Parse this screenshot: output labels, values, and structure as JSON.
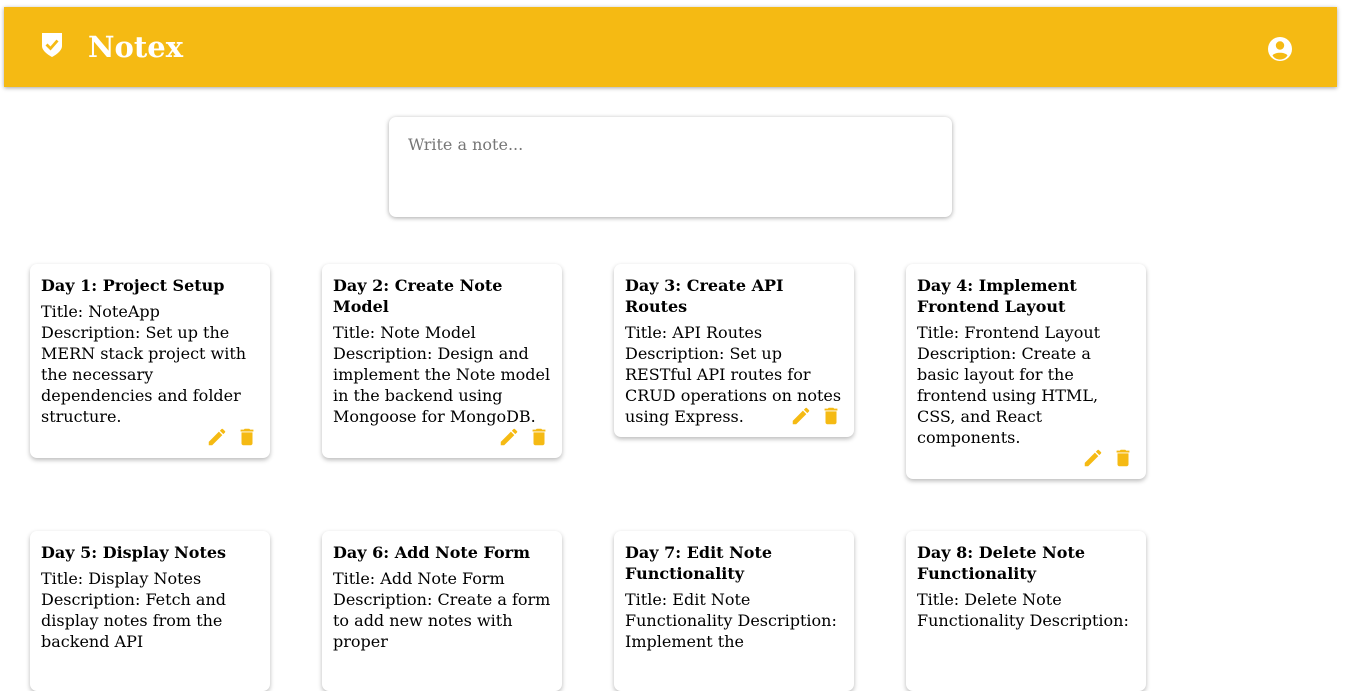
{
  "header": {
    "title": "Notex",
    "logo_icon": "check-shield-icon",
    "account_icon": "account-circle-icon",
    "color": "#f5ba13"
  },
  "composer": {
    "placeholder": "Write a note..."
  },
  "notes": [
    {
      "title": "Day 1: Project Setup",
      "content": "Title: NoteApp Description: Set up the MERN stack project with the necessary dependencies and folder structure."
    },
    {
      "title": "Day 2: Create Note Model",
      "content": "Title: Note Model Description: Design and implement the Note model in the backend using Mongoose for MongoDB."
    },
    {
      "title": "Day 3: Create API Routes",
      "content": "Title: API Routes Description: Set up RESTful API routes for CRUD operations on notes using Express."
    },
    {
      "title": "Day 4: Implement Frontend Layout",
      "content": "Title: Frontend Layout Description: Create a basic layout for the frontend using HTML, CSS, and React components."
    },
    {
      "title": "Day 5: Display Notes",
      "content": "Title: Display Notes Description: Fetch and display notes from the backend API"
    },
    {
      "title": "Day 6: Add Note Form",
      "content": "Title: Add Note Form Description: Create a form to add new notes with proper"
    },
    {
      "title": "Day 7: Edit Note Functionality",
      "content": "Title: Edit Note Functionality Description: Implement the"
    },
    {
      "title": "Day 8: Delete Note Functionality",
      "content": "Title: Delete Note Functionality Description:"
    }
  ],
  "note_actions": {
    "edit_icon": "pencil-icon",
    "delete_icon": "trash-icon"
  }
}
